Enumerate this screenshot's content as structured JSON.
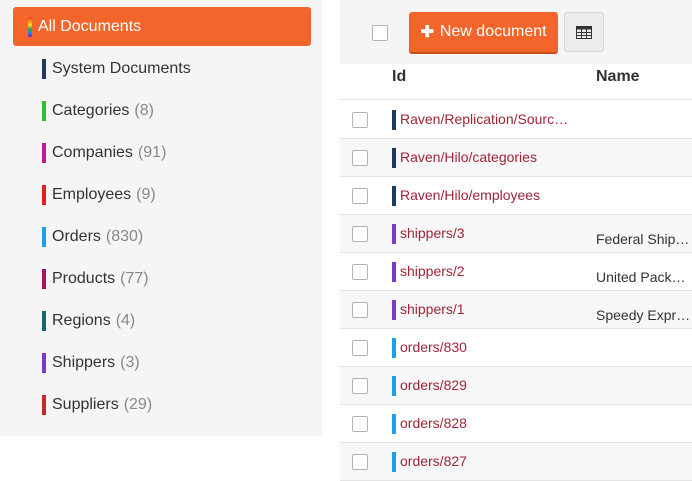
{
  "sidebar": {
    "all_documents": "All Documents",
    "collections": [
      {
        "name": "System Documents",
        "count": "",
        "color": "#1f3a5a"
      },
      {
        "name": "Categories",
        "count": "(8)",
        "color": "#2fbf2f"
      },
      {
        "name": "Companies",
        "count": "(91)",
        "color": "#c4189a"
      },
      {
        "name": "Employees",
        "count": "(9)",
        "color": "#e01f1f"
      },
      {
        "name": "Orders",
        "count": "(830)",
        "color": "#1aa0e8"
      },
      {
        "name": "Products",
        "count": "(77)",
        "color": "#a4145e"
      },
      {
        "name": "Regions",
        "count": "(4)",
        "color": "#146b6b"
      },
      {
        "name": "Shippers",
        "count": "(3)",
        "color": "#7a3cc4"
      },
      {
        "name": "Suppliers",
        "count": "(29)",
        "color": "#c42a2a"
      }
    ]
  },
  "toolbar": {
    "new_document_label": "New document",
    "plus_icon": "plus-icon",
    "table_view_icon": "table-icon"
  },
  "grid": {
    "columns": [
      "Id",
      "Name"
    ],
    "rows": [
      {
        "id": "Raven/Replication/Sources/...",
        "name": "",
        "color": "#1f3a5a"
      },
      {
        "id": "Raven/Hilo/categories",
        "name": "",
        "color": "#1f3a5a"
      },
      {
        "id": "Raven/Hilo/employees",
        "name": "",
        "color": "#1f3a5a"
      },
      {
        "id": "shippers/3",
        "name": "Federal Shipping",
        "color": "#7a3cc4"
      },
      {
        "id": "shippers/2",
        "name": "United Package",
        "color": "#7a3cc4"
      },
      {
        "id": "shippers/1",
        "name": "Speedy Express",
        "color": "#7a3cc4"
      },
      {
        "id": "orders/830",
        "name": "",
        "color": "#1aa0e8"
      },
      {
        "id": "orders/829",
        "name": "",
        "color": "#1aa0e8"
      },
      {
        "id": "orders/828",
        "name": "",
        "color": "#1aa0e8"
      },
      {
        "id": "orders/827",
        "name": "",
        "color": "#1aa0e8"
      }
    ]
  },
  "colors": {
    "accent": "#f3652a",
    "doc_link": "#a0243a"
  }
}
